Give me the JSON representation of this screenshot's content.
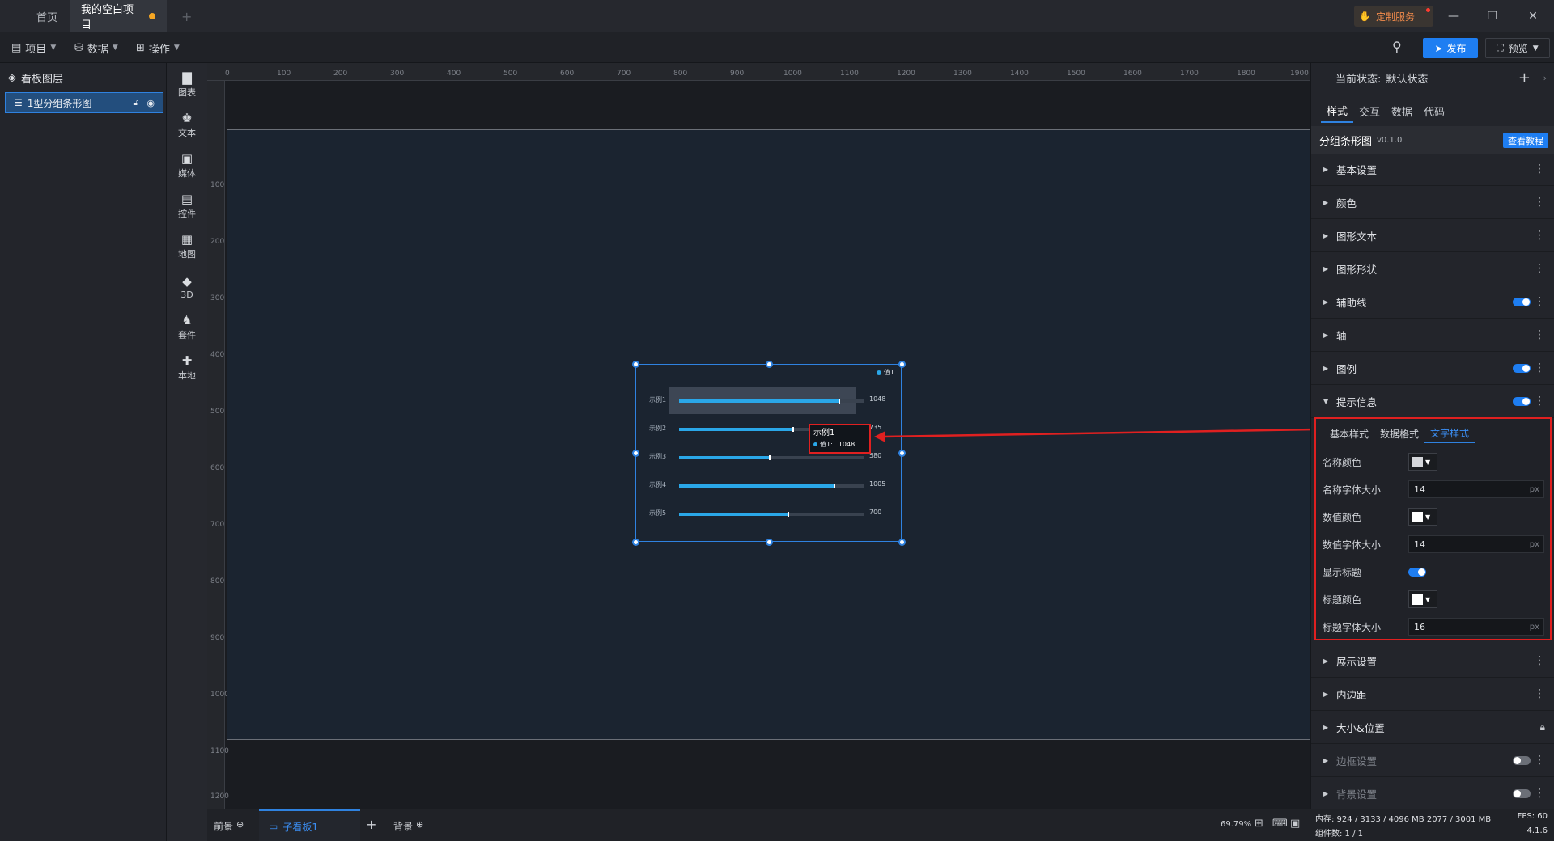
{
  "titlebar": {
    "tabs": [
      {
        "label": "首页"
      },
      {
        "label": "我的空白项目"
      }
    ],
    "add_tab": "+",
    "custom_service": "定制服务",
    "win_min": "—",
    "win_restore": "❐",
    "win_close": "✕"
  },
  "menubar": {
    "items": [
      {
        "label": "项目"
      },
      {
        "label": "数据"
      },
      {
        "label": "操作"
      }
    ],
    "publish": "发布",
    "preview": "预览"
  },
  "layers": {
    "title": "看板图层",
    "item": "1型分组条形图"
  },
  "tools": [
    {
      "label": "图表"
    },
    {
      "label": "文本"
    },
    {
      "label": "媒体"
    },
    {
      "label": "控件"
    },
    {
      "label": "地图"
    },
    {
      "label": "3D"
    },
    {
      "label": "套件"
    },
    {
      "label": "本地"
    }
  ],
  "rulers": {
    "top": [
      "0",
      "100",
      "200",
      "300",
      "400",
      "500",
      "600",
      "700",
      "800",
      "900",
      "1000",
      "1100",
      "1200",
      "1300",
      "1400",
      "1500",
      "1600",
      "1700",
      "1800",
      "1900"
    ],
    "left": [
      "100",
      "200",
      "300",
      "400",
      "500",
      "600",
      "700",
      "800",
      "900",
      "1000",
      "1100",
      "1200"
    ]
  },
  "chart": {
    "legend": "值1",
    "rows": [
      {
        "label": "示例1",
        "value": "1048",
        "fraction": 0.87
      },
      {
        "label": "示例2",
        "value": "735",
        "fraction": 0.62
      },
      {
        "label": "示例3",
        "value": "580",
        "fraction": 0.49
      },
      {
        "label": "示例4",
        "value": "1005",
        "fraction": 0.84
      },
      {
        "label": "示例5",
        "value": "700",
        "fraction": 0.59
      }
    ],
    "tooltip_title": "示例1",
    "tooltip_series": "值1:",
    "tooltip_value": "1048",
    "colors": {
      "bar": "#2aa7e8",
      "track": "#39424f",
      "highlight": "#e02020"
    }
  },
  "right_panel": {
    "state_label": "当前状态:",
    "state_value": "默认状态",
    "add": "+",
    "tabs": [
      {
        "label": "样式"
      },
      {
        "label": "交互"
      },
      {
        "label": "数据"
      },
      {
        "label": "代码"
      }
    ],
    "component_name": "分组条形图",
    "component_version": "v0.1.0",
    "tutorial": "查看教程",
    "sections_top": [
      {
        "label": "基本设置"
      },
      {
        "label": "颜色"
      },
      {
        "label": "图形文本"
      },
      {
        "label": "图形形状"
      },
      {
        "label": "辅助线"
      },
      {
        "label": "轴"
      },
      {
        "label": "图例"
      },
      {
        "label": "提示信息"
      }
    ],
    "tooltip_subtabs": [
      {
        "label": "基本样式"
      },
      {
        "label": "数据格式"
      },
      {
        "label": "文字样式"
      }
    ],
    "tooltip_props": {
      "name_color": "名称颜色",
      "name_font_size": "名称字体大小",
      "name_font_size_value": "14",
      "value_color": "数值颜色",
      "value_font_size": "数值字体大小",
      "value_font_size_value": "14",
      "show_title": "显示标题",
      "title_color": "标题颜色",
      "title_font_size": "标题字体大小",
      "title_font_size_value": "16",
      "unit": "px"
    },
    "sections_bottom": [
      {
        "label": "展示设置"
      },
      {
        "label": "内边距"
      },
      {
        "label": "大小&位置"
      },
      {
        "label": "边框设置"
      },
      {
        "label": "背景设置"
      }
    ]
  },
  "bottombar": {
    "foreground": "前景",
    "subboard": "子看板1",
    "add": "+",
    "background": "背景",
    "zoom": "69.79%"
  },
  "statusbar": {
    "memory": "内存: 924 / 3133 / 4096 MB  2077 / 3001 MB",
    "fps": "FPS: 60",
    "components": "组件数: 1 / 1",
    "version": "4.1.6"
  }
}
